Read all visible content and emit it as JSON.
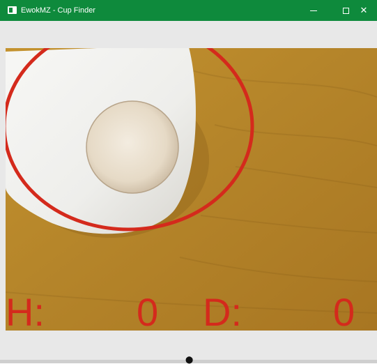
{
  "window": {
    "title": "EwokMZ - Cup Finder",
    "icons": {
      "app": "app-window-icon",
      "minimize": "minimize-icon",
      "maximize": "maximize-icon",
      "close": "close-icon"
    },
    "close_glyph": "✕",
    "accent": "#0e8a3c"
  },
  "readout": {
    "h_label": "H:",
    "h_value": "0",
    "d_label": "D:",
    "d_value": "0",
    "color": "#d42a1c"
  },
  "detection": {
    "marker": "red-ellipse",
    "color": "#d42a1c"
  }
}
